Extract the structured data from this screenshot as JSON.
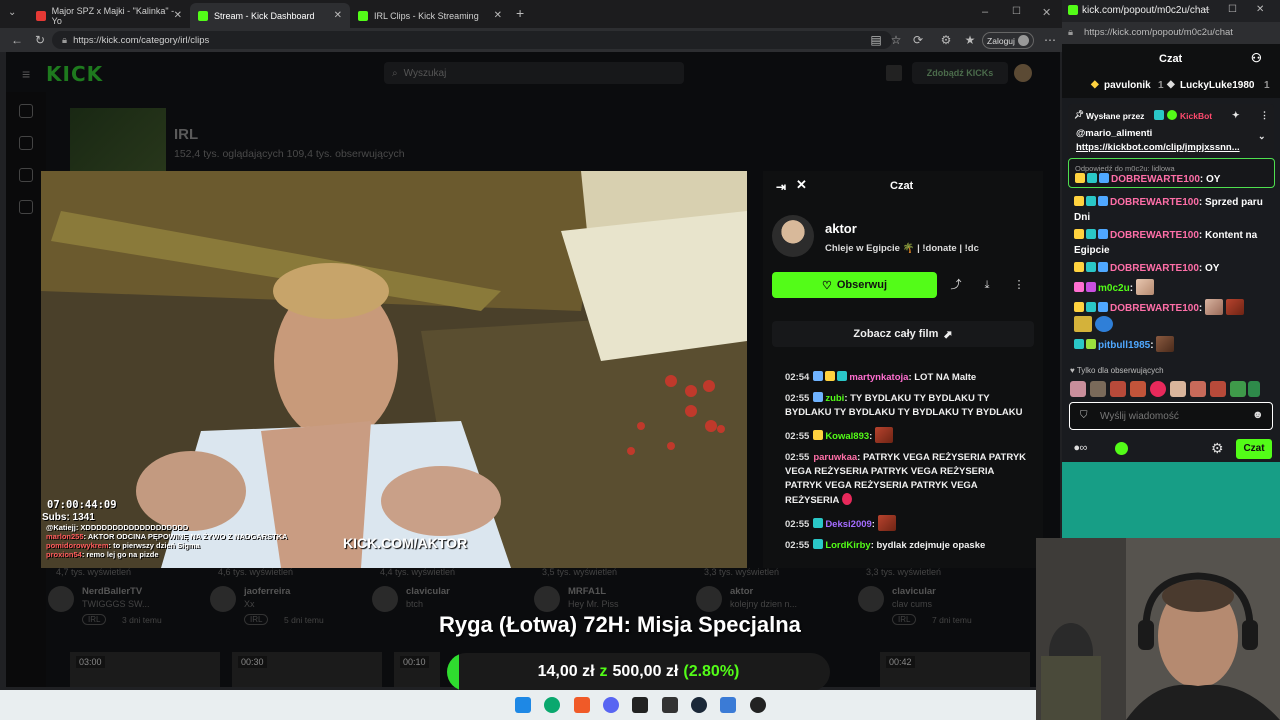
{
  "browser": {
    "tabs": [
      {
        "label": "Major SPZ x Majki - \"Kalinka\" - Yo",
        "active": false,
        "color": "#e53935"
      },
      {
        "label": "Stream - Kick Dashboard",
        "active": true,
        "color": "#53fc18"
      },
      {
        "label": "IRL Clips - Kick Streaming",
        "active": false,
        "color": "#53fc18"
      }
    ],
    "url": "https://kick.com/category/irl/clips",
    "login_label": "Zaloguj"
  },
  "kick": {
    "logo": "KICK",
    "search_placeholder": "Wyszukaj",
    "get_kicks": "Zdobądź KICKs",
    "category": {
      "title": "IRL",
      "stats": "152,4 tys. oglądających  109,4 tys. obserwujących"
    },
    "cards": [
      {
        "views": "4,7 tys. wyświetleń",
        "name": "NerdBallerTV",
        "title": "TWIGGGS SW...",
        "cat": "IRL",
        "age": "3 dni temu"
      },
      {
        "views": "4,6 tys. wyświetleń",
        "name": "jaoferreira",
        "title": "Xx",
        "cat": "IRL",
        "age": "5 dni temu"
      },
      {
        "views": "4,4 tys. wyświetleń",
        "name": "clavicular",
        "title": "btch",
        "cat": "IRL",
        "age": ""
      },
      {
        "views": "3,5 tys. wyświetleń",
        "name": "MRFA1L",
        "title": "Hey Mr. Piss",
        "cat": "",
        "age": ""
      },
      {
        "views": "3,3 tys. wyświetleń",
        "name": "aktor",
        "title": "kolejny dzien n...",
        "cat": "",
        "age": ""
      },
      {
        "views": "3,3 tys. wyświetleń",
        "name": "clavicular",
        "title": "clav cums",
        "cat": "IRL",
        "age": "7 dni temu"
      }
    ],
    "durations": [
      "03:00",
      "00:30",
      "00:10",
      "00:42"
    ]
  },
  "video": {
    "timer": "07:00:44:09",
    "subs": "Subs: 1341",
    "watermark": "KICK.COM/AKTOR",
    "overlay_chat": [
      {
        "user": "@Katiejj",
        "text": ": XDDDDDDDDDDDDDDDDDDD",
        "color": "#ffffff"
      },
      {
        "user": "marlon255",
        "text": ": AKTOR ODCINA PĘPOWINĘ NA ŻYWO Z NADGARSTKA",
        "color": "#ff5b5b"
      },
      {
        "user": "pomidorowykrem",
        "text": ": to pierwszy dzień Sigma",
        "color": "#ff5b5b"
      },
      {
        "user": "proxion54",
        "text": ": remo lej go na pizde",
        "color": "#ff5b5b"
      }
    ]
  },
  "clip_panel": {
    "header": "Czat",
    "streamer": "aktor",
    "stream_title": "Chleje w Egipcie 🌴 | !donate | !dc",
    "follow": "Obserwuj",
    "full_film": "Zobacz cały film",
    "messages": [
      {
        "time": "02:54",
        "user": "martynkatoja",
        "color": "#ff6fd0",
        "text": ": LOT NA Malte"
      },
      {
        "time": "02:55",
        "user": "zubi",
        "color": "#53fc18",
        "text": ": TY BYDLAKU TY BYDLAKU TY BYDLAKU TY BYDLAKU TY BYDLAKU TY BYDLAKU"
      },
      {
        "time": "02:55",
        "user": "Kowal893",
        "color": "#53fc18",
        "text": ":"
      },
      {
        "time": "02:55",
        "user": "paruwkaa",
        "color": "#ff6fa8",
        "text": ": PATRYK VEGA REŻYSERIA PATRYK VEGA REŻYSERIA PATRYK VEGA REŻYSERIA PATRYK VEGA REŻYSERIA PATRYK VEGA REŻYSERIA"
      },
      {
        "time": "02:55",
        "user": "Deksi2009",
        "color": "#a46cff",
        "text": ":"
      },
      {
        "time": "02:55",
        "user": "LordKirby",
        "color": "#53fc18",
        "text": ": bydlak zdejmuje opaske"
      }
    ]
  },
  "goal": {
    "title": "Ryga (Łotwa) 72H: Misja Specjalna",
    "current": "14,00 zł",
    "sep": "z",
    "target": "500,00 zł",
    "pct": "(2.80%)",
    "fraction": 0.028
  },
  "popout": {
    "url_title": "kick.com/popout/m0c2u/chat",
    "url": "https://kick.com/popout/m0c2u/chat",
    "header": "Czat",
    "gifters": [
      {
        "name": "pavulonik",
        "count": "1"
      },
      {
        "name": "LuckyLuke1980",
        "count": "1"
      }
    ],
    "pinned_by": "Wysłane przez",
    "pinned_bot": "KickBot",
    "pinned_mention": "@mario_alimenti",
    "pinned_link": "https://kickbot.com/clip/jmpjxssnn...",
    "reply_to": "Odpowiedź do m0c2u: lidlowa",
    "messages": [
      {
        "user": "DOBREWARTE100",
        "color": "#ff6fa8",
        "text": ": OY"
      },
      {
        "user": "DOBREWARTE100",
        "color": "#ff6fa8",
        "text": ": Sprzed paru Dni"
      },
      {
        "user": "DOBREWARTE100",
        "color": "#ff6fa8",
        "text": ": Kontent na Egipcie"
      },
      {
        "user": "DOBREWARTE100",
        "color": "#ff6fa8",
        "text": ": OY"
      },
      {
        "user": "m0c2u",
        "color": "#53fc18",
        "text": ":"
      },
      {
        "user": "DOBREWARTE100",
        "color": "#ff6fa8",
        "text": ":"
      },
      {
        "user": "pitbull1985",
        "color": "#4fa8ff",
        "text": ":"
      }
    ],
    "followers_only": "Tylko dla obserwujących",
    "send_placeholder": "Wyślij wiadomość",
    "send_button": "Czat"
  }
}
